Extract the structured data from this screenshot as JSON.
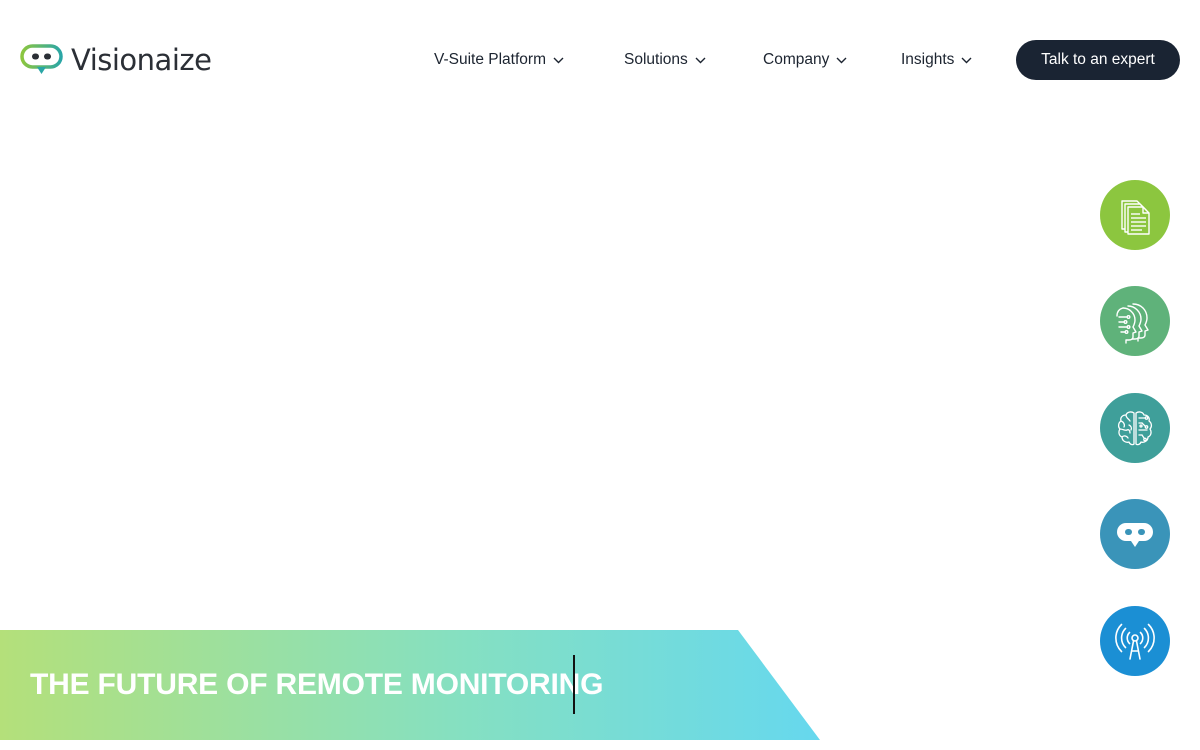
{
  "brand": {
    "name": "Visionaize",
    "colors": {
      "logo_green": "#8cc63f",
      "logo_teal": "#2aa6a6",
      "logo_dark": "#2b2f36"
    }
  },
  "nav": {
    "items": [
      {
        "label": "V-Suite Platform",
        "icon": "chevron-down-icon"
      },
      {
        "label": "Solutions",
        "icon": "chevron-down-icon"
      },
      {
        "label": "Company",
        "icon": "chevron-down-icon"
      },
      {
        "label": "Insights",
        "icon": "chevron-down-icon"
      }
    ],
    "cta_label": "Talk to an expert",
    "cta_color": "#1a2433"
  },
  "feature_icons": [
    {
      "icon": "documents-icon",
      "color": "#8cc63f"
    },
    {
      "icon": "ai-heads-icon",
      "color": "#5fb27a"
    },
    {
      "icon": "brain-icon",
      "color": "#3f9f9a"
    },
    {
      "icon": "chat-bot-icon",
      "color": "#3a94b9"
    },
    {
      "icon": "signal-tower-icon",
      "color": "#1b8fd4"
    }
  ],
  "hero": {
    "title": "THE FUTURE OF REMOTE MONITORING",
    "gradient_start": "#b4e07a",
    "gradient_mid": "#86e0c0",
    "gradient_end": "#66d8ee"
  }
}
